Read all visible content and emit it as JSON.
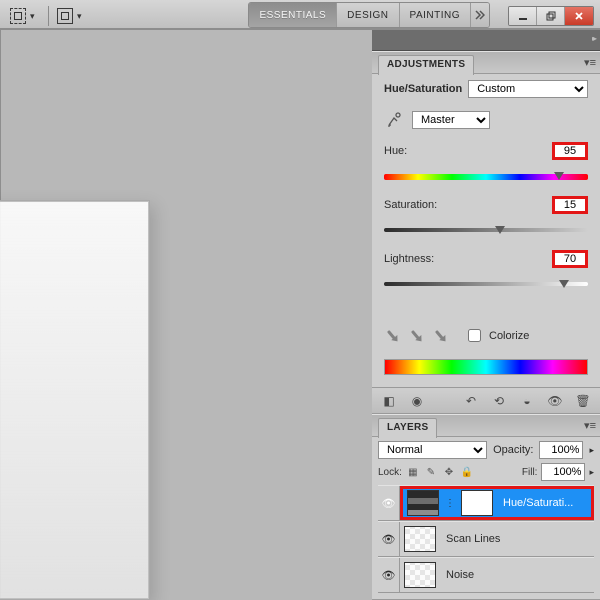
{
  "workspaces": {
    "essentials": "ESSENTIALS",
    "design": "DESIGN",
    "painting": "PAINTING"
  },
  "adjustments": {
    "title": "ADJUSTMENTS",
    "type_label": "Hue/Saturation",
    "preset": "Custom",
    "range": "Master",
    "hue": {
      "label": "Hue:",
      "value": "95",
      "pos": 86
    },
    "saturation": {
      "label": "Saturation:",
      "value": "15",
      "pos": 57
    },
    "lightness": {
      "label": "Lightness:",
      "value": "70",
      "pos": 88
    },
    "colorize_label": "Colorize"
  },
  "layers": {
    "title": "LAYERS",
    "blend_mode": "Normal",
    "opacity_label": "Opacity:",
    "opacity_value": "100%",
    "lock_label": "Lock:",
    "fill_label": "Fill:",
    "fill_value": "100%",
    "items": [
      {
        "name": "Hue/Saturati...",
        "selected": true
      },
      {
        "name": "Scan Lines",
        "selected": false
      },
      {
        "name": "Noise",
        "selected": false
      }
    ]
  }
}
